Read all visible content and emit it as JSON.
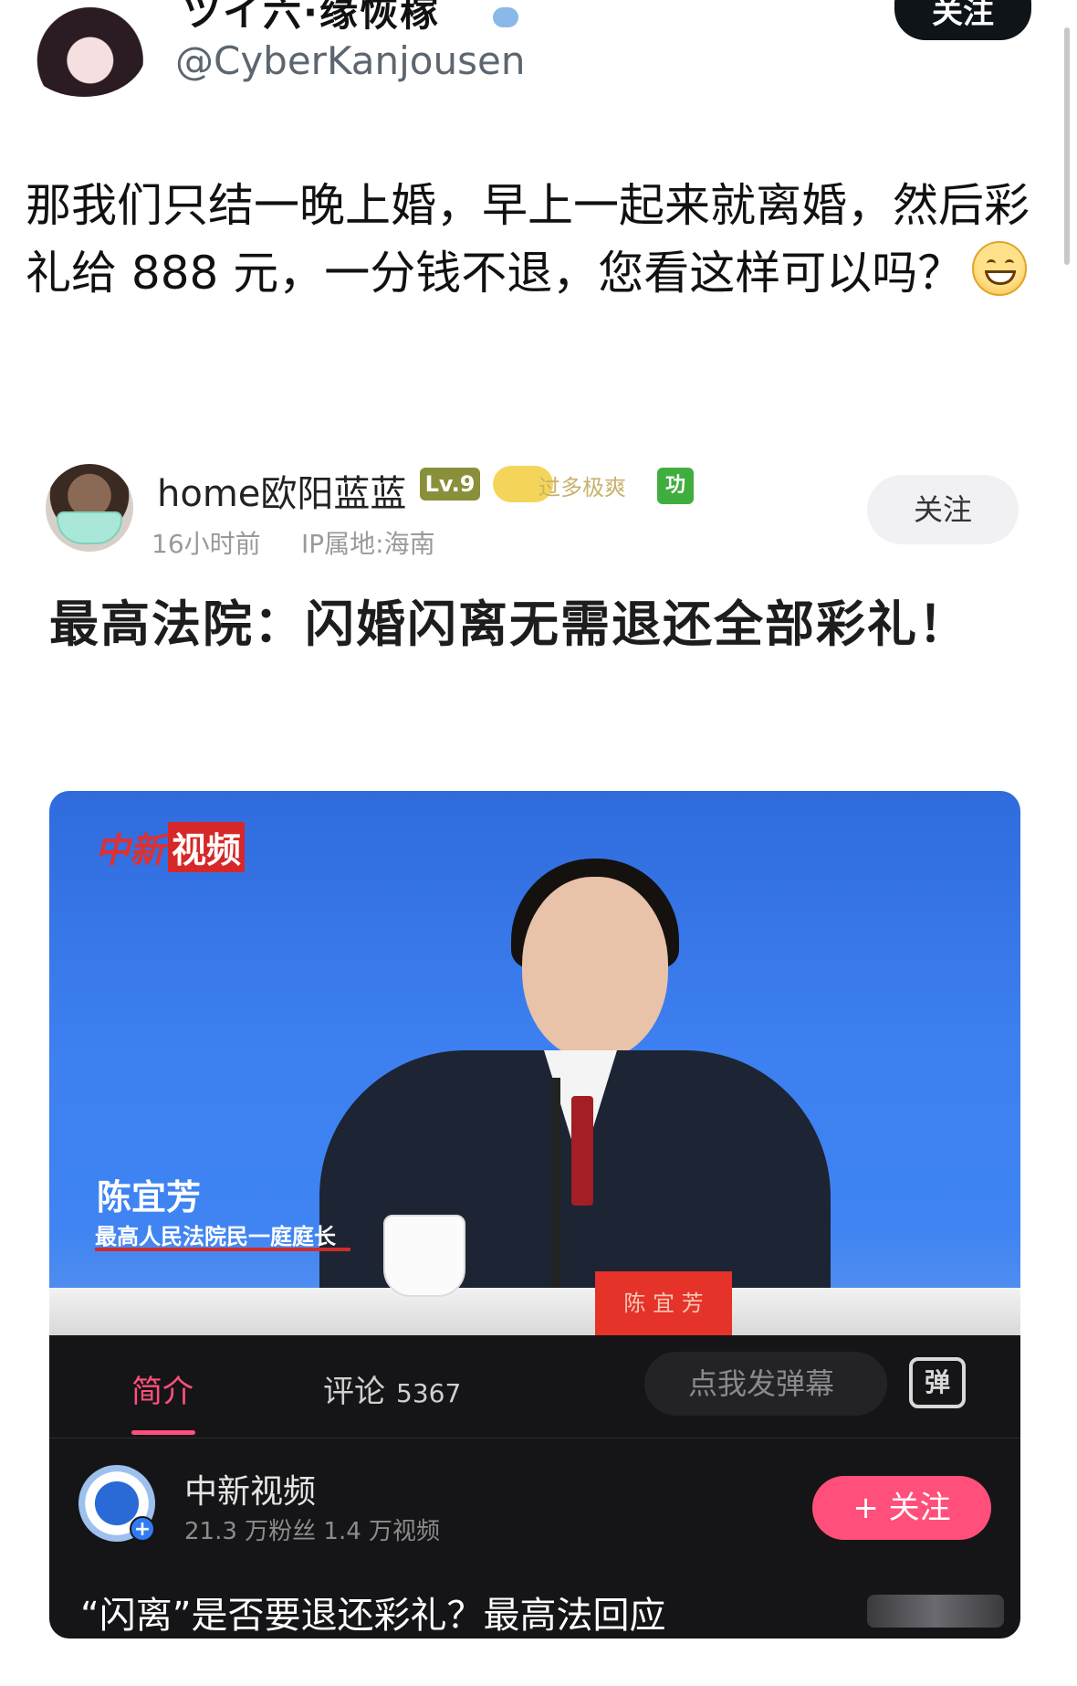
{
  "tweet": {
    "display_name": "ツイ六·缘恢稼",
    "handle": "@CyberKanjousen",
    "follow_label": "关注",
    "text": "那我们只结一晚上婚，早上一起来就离婚，然后彩礼给 888 元，一分钱不退，您看这样可以吗？",
    "emoji": "grinning-face"
  },
  "weibo_post": {
    "username": "home欧阳蓝蓝",
    "level_badge": "Lv.9",
    "gold_badge": "过多极爽",
    "green_badge": "功",
    "time": "16小时前",
    "ip_location": "IP属地:海南",
    "follow_label": "关注",
    "title": "最高法院：闪婚闪离无需退还全部彩礼！"
  },
  "video": {
    "logo_prefix": "中新",
    "logo_suffix": "视频",
    "caption_name": "陈宜芳",
    "caption_role": "最高人民法院民一庭庭长",
    "nameplate": "陈 宜 芳"
  },
  "app_panel": {
    "tabs": [
      {
        "label": "简介",
        "active": true
      },
      {
        "label": "评论",
        "count": "5367",
        "active": false
      }
    ],
    "danmaku_placeholder": "点我发弹幕",
    "danmaku_icon_label": "弹",
    "channel": {
      "name": "中新视频",
      "stats": "21.3 万粉丝  1.4 万视频",
      "follow_label": "+ 关注"
    },
    "video_title": "“闪离”是否要退还彩礼？最高法回应"
  },
  "colors": {
    "accent_pink": "#ff4f7a",
    "panel_bg": "#151517",
    "video_blue": "#3d7ff0",
    "follow_black": "#0f1419"
  }
}
